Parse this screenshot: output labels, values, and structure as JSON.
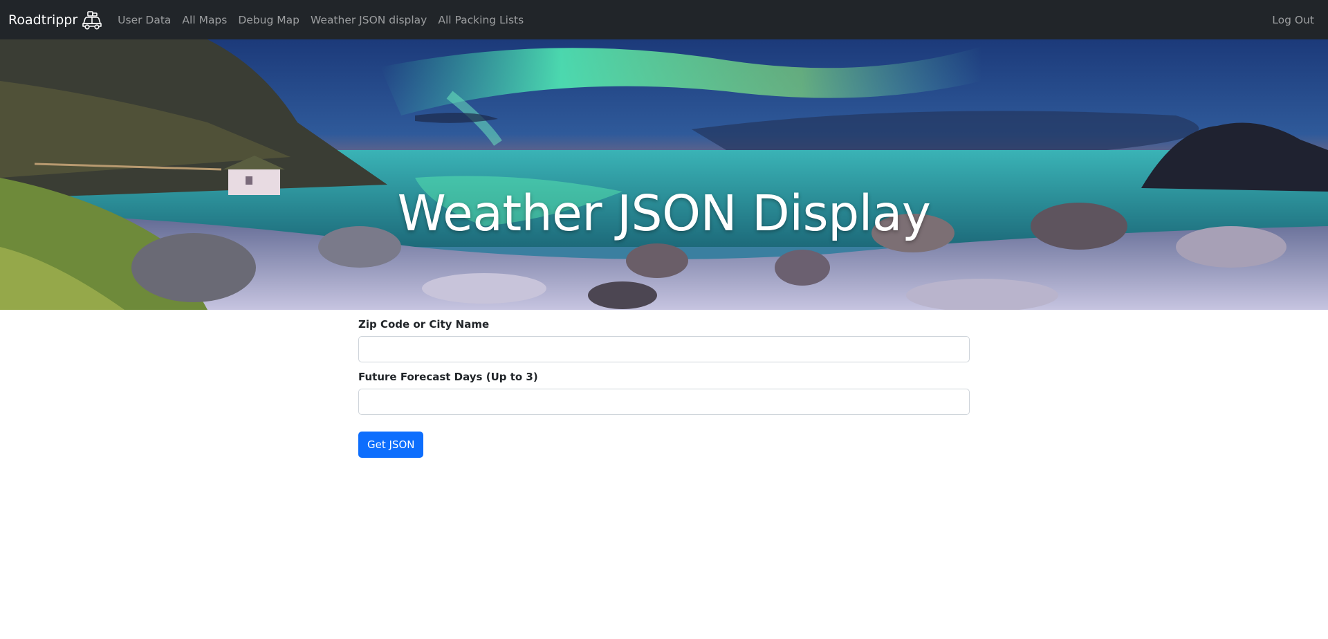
{
  "navbar": {
    "brand": "Roadtrippr",
    "brand_icon": "car-with-luggage-icon",
    "links": [
      "User Data",
      "All Maps",
      "Debug Map",
      "Weather JSON display",
      "All Packing Lists"
    ],
    "logout": "Log Out"
  },
  "hero": {
    "title": "Weather JSON Display"
  },
  "form": {
    "location_label": "Zip Code or City Name",
    "location_value": "",
    "days_label": "Future Forecast Days (Up to 3)",
    "days_value": "",
    "submit_label": "Get JSON"
  },
  "colors": {
    "navbar_bg": "#212529",
    "primary": "#0d6efd"
  }
}
